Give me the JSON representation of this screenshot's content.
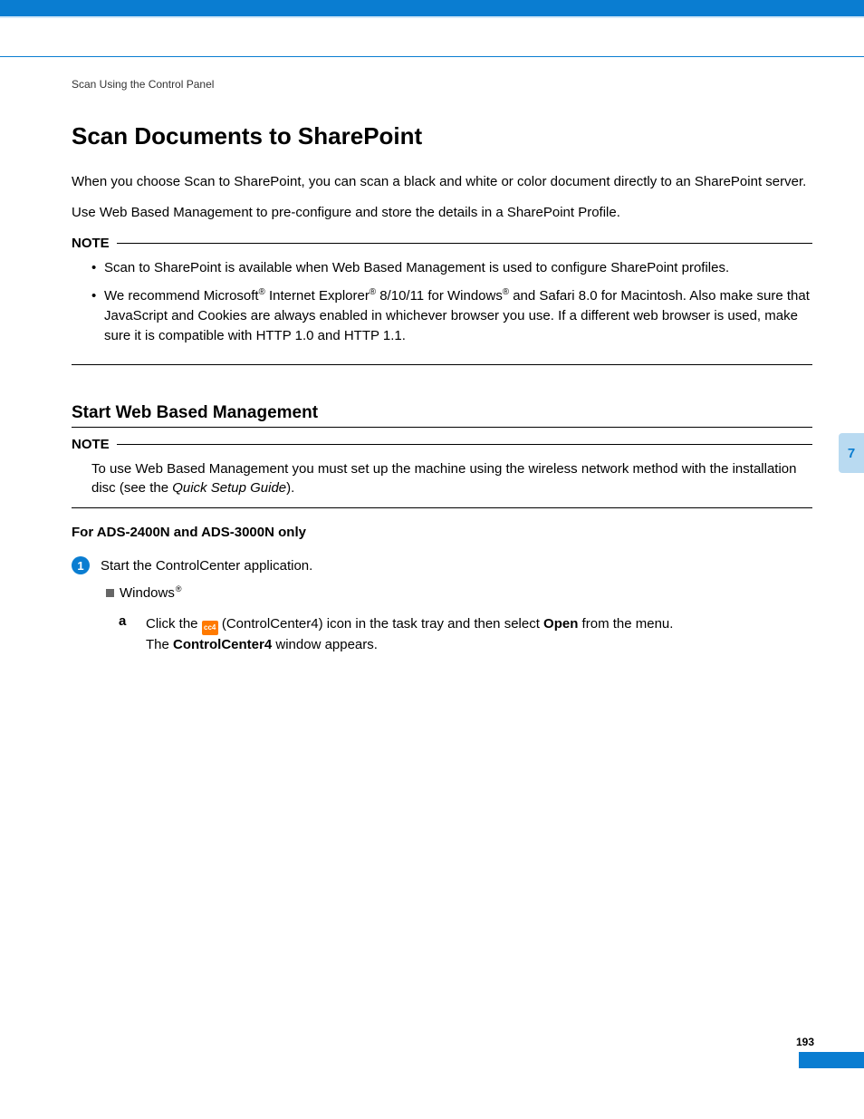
{
  "header": {
    "breadcrumb": "Scan Using the Control Panel"
  },
  "main": {
    "title": "Scan Documents to SharePoint",
    "intro1": "When you choose Scan to SharePoint, you can scan a black and white or color document directly to an SharePoint server.",
    "intro2": "Use Web Based Management to pre-configure and store the details in a SharePoint Profile.",
    "note1": {
      "label": "NOTE",
      "bullets": [
        "Scan to SharePoint is available when Web Based Management is used to configure SharePoint profiles."
      ],
      "bullet2": {
        "pre": "We recommend Microsoft",
        "sup1": "®",
        "mid1": " Internet Explorer",
        "sup2": "®",
        "mid2": " 8/10/11 for Windows",
        "sup3": "®",
        "post": " and Safari 8.0 for Macintosh. Also make sure that JavaScript and Cookies are always enabled in whichever browser you use. If a different web browser is used, make sure it is compatible with HTTP 1.0 and HTTP 1.1."
      }
    },
    "section": {
      "heading": "Start Web Based Management"
    },
    "note2": {
      "label": "NOTE",
      "text_pre": "To use Web Based Management you must set up the machine using the wireless network method with the installation disc (see the ",
      "text_em": "Quick Setup Guide",
      "text_post": ")."
    },
    "model_line": "For ADS-2400N and ADS-3000N only",
    "step1": {
      "num": "1",
      "text": "Start the ControlCenter application.",
      "os_label": "Windows",
      "os_sup": "®",
      "sub_a": {
        "letter": "a",
        "pre": "Click the ",
        "icon_text": "cc4",
        "mid1": " (ControlCenter4) icon in the task tray and then select ",
        "bold1": "Open",
        "mid2": " from the menu.",
        "line2_pre": "The ",
        "bold2": "ControlCenter4",
        "line2_post": " window appears."
      }
    }
  },
  "footer": {
    "chapter": "7",
    "page": "193"
  }
}
